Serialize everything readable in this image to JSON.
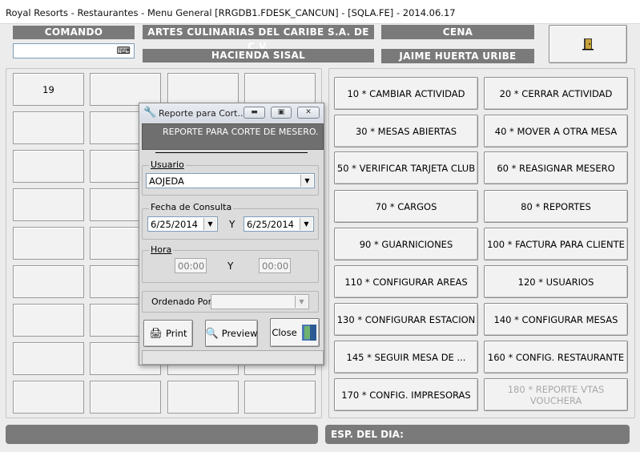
{
  "window": {
    "title": "Royal Resorts - Restaurantes - Menu General [RRGDB1.FDESK_CANCUN] - [SQLA.FE] - 2014.06.17"
  },
  "header": {
    "command_label": "COMANDO",
    "command_value": "",
    "company": "ARTES CULINARIAS DEL CARIBE S.A. DE C.V.",
    "restaurant": "HACIENDA SISAL",
    "meal_period": "CENA",
    "user_name": "JAIME HUERTA URIBE"
  },
  "tables": {
    "first_table": "19"
  },
  "menu": [
    {
      "label": "10 * CAMBIAR ACTIVIDAD",
      "enabled": true
    },
    {
      "label": "20 * CERRAR ACTIVIDAD",
      "enabled": true
    },
    {
      "label": "30 * MESAS ABIERTAS",
      "enabled": true
    },
    {
      "label": "40 * MOVER A OTRA MESA",
      "enabled": true
    },
    {
      "label": "50 * VERIFICAR TARJETA CLUB",
      "enabled": true
    },
    {
      "label": "60 * REASIGNAR MESERO",
      "enabled": true
    },
    {
      "label": "70 * CARGOS",
      "enabled": true
    },
    {
      "label": "80 * REPORTES",
      "enabled": true
    },
    {
      "label": "90 * GUARNICIONES",
      "enabled": true
    },
    {
      "label": "100 * FACTURA PARA CLIENTE",
      "enabled": true
    },
    {
      "label": "110 * CONFIGURAR AREAS",
      "enabled": true
    },
    {
      "label": "120 * USUARIOS",
      "enabled": true
    },
    {
      "label": "130 * CONFIGURAR ESTACION",
      "enabled": true
    },
    {
      "label": "140 * CONFIGURAR MESAS",
      "enabled": true
    },
    {
      "label": "145 * SEGUIR MESA DE ...",
      "enabled": true
    },
    {
      "label": "160 * CONFIG. RESTAURANTE",
      "enabled": true
    },
    {
      "label": "170 * CONFIG. IMPRESORAS",
      "enabled": true
    },
    {
      "label": "180 * REPORTE VTAS VOUCHERA",
      "enabled": false
    }
  ],
  "dialog": {
    "title": "Reporte para Cort...",
    "heading": "REPORTE PARA CORTE DE MESERO.",
    "user_label": "Usuario",
    "user_value": "AOJEDA",
    "date_label": "Fecha de Consulta",
    "date_from": "6/25/2014",
    "date_sep": "Y",
    "date_to": "6/25/2014",
    "time_label": "Hora",
    "time_from": "00:00",
    "time_sep": "Y",
    "time_to": "00:00",
    "order_label": "Ordenado Por",
    "order_value": "",
    "print_label": "Print",
    "preview_label": "Preview",
    "close_label": "Close"
  },
  "footer": {
    "left_text": "",
    "specials_label": "ESP. DEL DIA:"
  }
}
